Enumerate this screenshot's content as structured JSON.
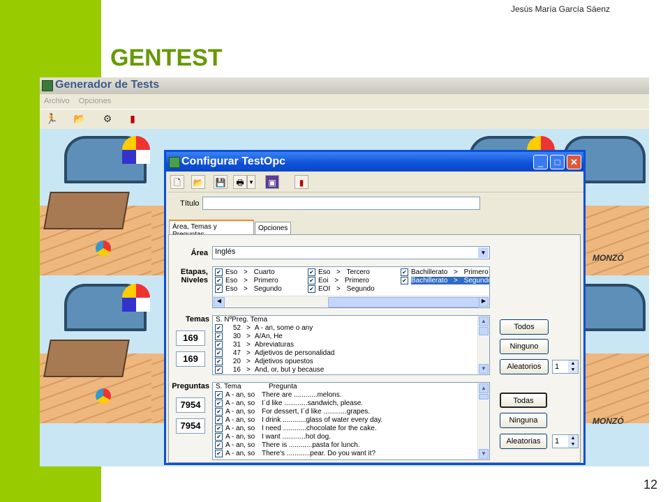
{
  "slide": {
    "author": "Jesús María García Sáenz",
    "title": "GENTEST",
    "page_number": "12"
  },
  "app": {
    "title": "Generador de Tests",
    "menu": [
      "Archivo",
      "Opciones"
    ],
    "background_signature": "MONZÓ"
  },
  "dialog": {
    "title": "Configurar TestOpc",
    "titulo_label": "Título",
    "titulo_value": "",
    "tabs": [
      "Área, Temas y Preguntas",
      "Opciones"
    ],
    "area_label": "Área",
    "area_value": "Inglés",
    "etapas_label_1": "Etapas,",
    "etapas_label_2": "Niveles",
    "etapas": [
      [
        "Eso",
        ">",
        "Cuarto"
      ],
      [
        "Eso",
        ">",
        "Tercero"
      ],
      [
        "Bachillerato",
        ">",
        "Primero"
      ],
      [
        "Eso",
        ">",
        "Primero"
      ],
      [
        "Eoi",
        ">",
        "Primero"
      ],
      [
        "Bachillerato",
        ">",
        "Segundo"
      ],
      [
        "Eso",
        ">",
        "Segundo"
      ],
      [
        "EOI",
        ">",
        "Segundo"
      ]
    ],
    "temas_label": "Temas",
    "temas_header": "S. NºPreg.  Tema",
    "temas_count_1": "169",
    "temas_count_2": "169",
    "temas": [
      {
        "n": "52",
        "tema": "A - an, some o any"
      },
      {
        "n": "30",
        "tema": "A/An, He"
      },
      {
        "n": "31",
        "tema": "Abreviaturas"
      },
      {
        "n": "47",
        "tema": "Adjetivos de personalidad"
      },
      {
        "n": "20",
        "tema": "Adjetivos opuestos"
      },
      {
        "n": "16",
        "tema": "And, or, but y because"
      }
    ],
    "temas_buttons": [
      "Todos",
      "Ninguno",
      "Aleatorios"
    ],
    "temas_random": "1",
    "preguntas_label": "Preguntas",
    "preguntas_header_s": "S.  Tema",
    "preguntas_header_p": "Pregunta",
    "preguntas_count_1": "7954",
    "preguntas_count_2": "7954",
    "preguntas": [
      {
        "tema": "A - an, so",
        "p": "There are ............melons."
      },
      {
        "tema": "A - an, so",
        "p": "I´d like ............sandwich, please."
      },
      {
        "tema": "A - an, so",
        "p": "For dessert, I´d like ............grapes."
      },
      {
        "tema": "A - an, so",
        "p": "I drink ............glass of water every day."
      },
      {
        "tema": "A - an, so",
        "p": "I need ............chocolate for the cake."
      },
      {
        "tema": "A - an, so",
        "p": "I want ............hot dog."
      },
      {
        "tema": "A - an, so",
        "p": "There is ............pasta for lunch."
      },
      {
        "tema": "A - an, so",
        "p": "There's ............pear. Do you want it?"
      }
    ],
    "preguntas_buttons": [
      "Todas",
      "Ninguna",
      "Aleatorias"
    ],
    "preguntas_random": "1"
  }
}
